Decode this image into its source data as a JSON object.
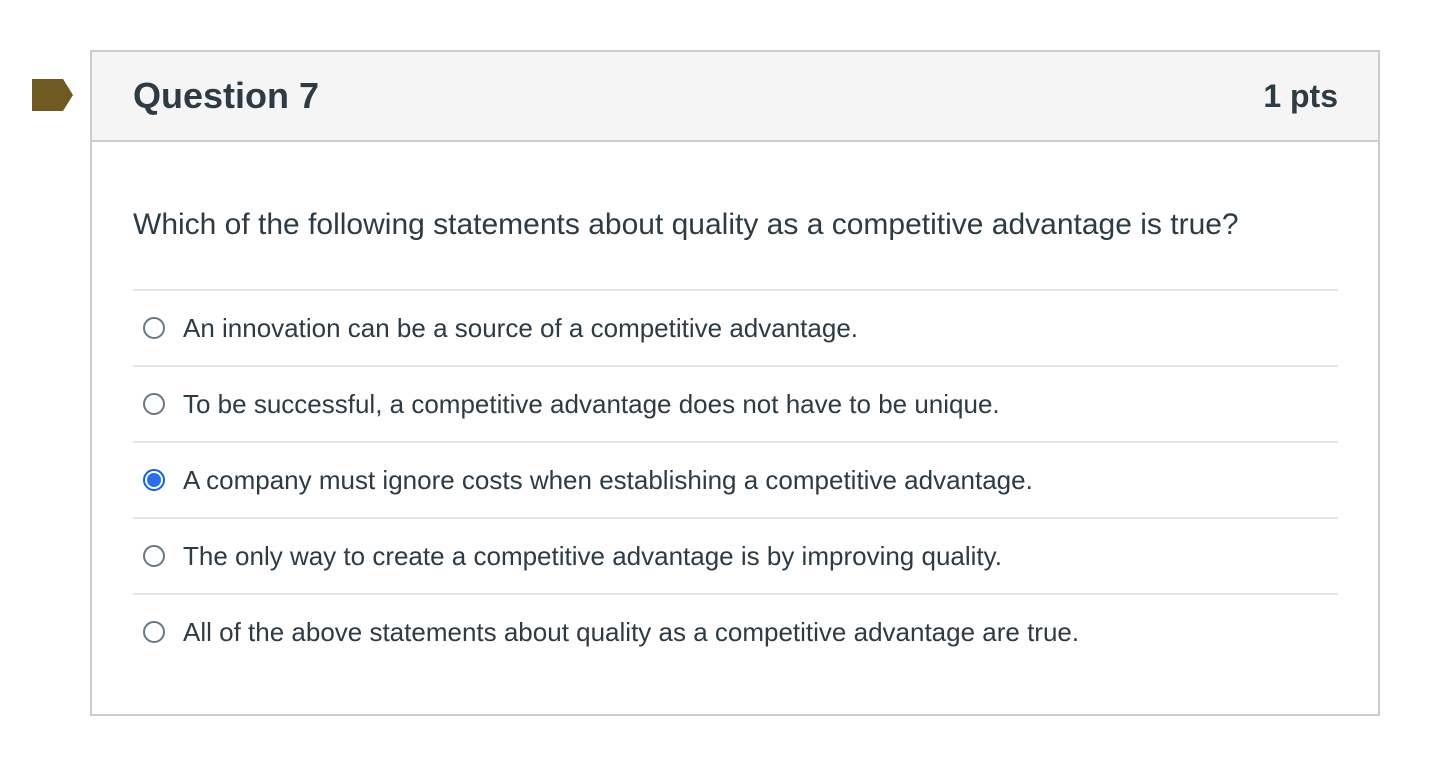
{
  "question": {
    "title": "Question 7",
    "points": "1 pts",
    "text": "Which of the following statements about quality as a competitive advantage is true?",
    "flag_icon": "bookmark-flag-icon",
    "flag_color": "#6e5a22",
    "selected_index": 2,
    "answers": [
      {
        "label": "An innovation can be a source of a competitive advantage.",
        "selected": false
      },
      {
        "label": "To be successful, a competitive advantage does not have to be unique.",
        "selected": false
      },
      {
        "label": "A company must ignore costs when establishing a competitive advantage.",
        "selected": true
      },
      {
        "label": "The only way to create a competitive advantage is by improving quality.",
        "selected": false
      },
      {
        "label": "All of the above statements about quality as a competitive advantage are true.",
        "selected": false
      }
    ]
  },
  "colors": {
    "header_bg": "#f5f5f5",
    "border": "#c7cdd1",
    "text": "#2d3b45",
    "radio_selected": "#2b6de9"
  }
}
